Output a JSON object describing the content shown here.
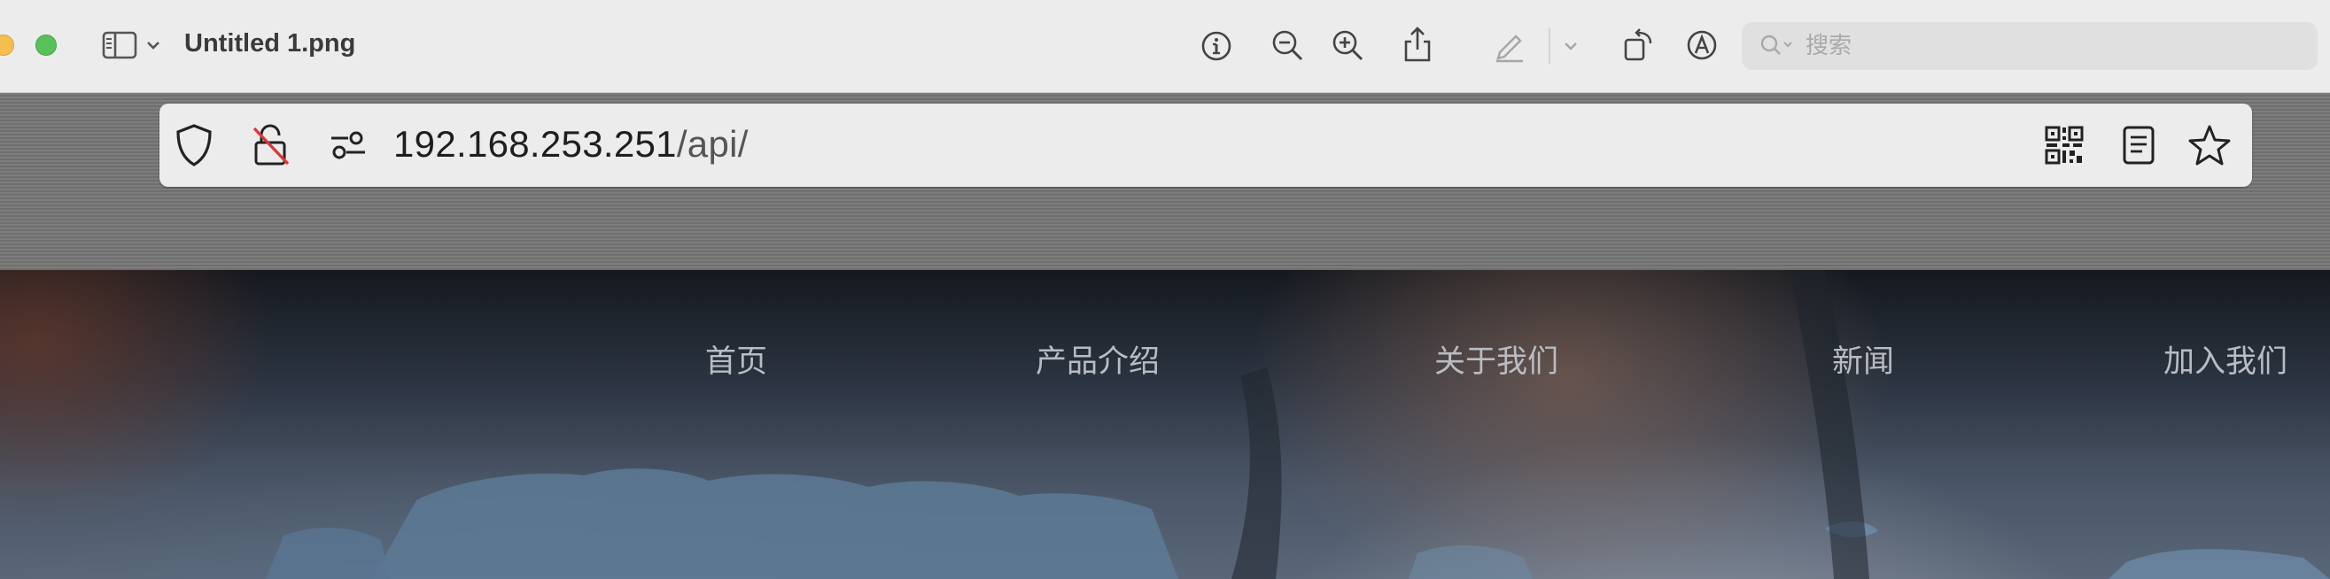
{
  "window": {
    "title": "Untitled 1.png",
    "search": {
      "placeholder": "搜索",
      "value": ""
    }
  },
  "toolbar_icons": [
    "sidebar-toggle-icon",
    "chevron-down-icon",
    "info-icon",
    "zoom-out-icon",
    "zoom-in-icon",
    "share-icon",
    "markup-pencil-icon",
    "markup-chevron-icon",
    "rotate-icon",
    "annotate-icon",
    "search-icon"
  ],
  "browser": {
    "url_host": "192.168.253.251",
    "url_path": "/api/",
    "icons": [
      "shield-icon",
      "insecure-lock-icon",
      "site-settings-icon",
      "qr-code-icon",
      "reader-mode-icon",
      "bookmark-star-icon"
    ]
  },
  "site_nav": {
    "items": [
      {
        "label": "首页"
      },
      {
        "label": "产品介绍"
      },
      {
        "label": "关于我们"
      },
      {
        "label": "新闻"
      },
      {
        "label": "加入我们"
      }
    ]
  },
  "colors": {
    "toolbar_bg": "#ececec",
    "traffic_yellow": "#f5bf4f",
    "traffic_green": "#5ac05a",
    "insecure_red": "#d63a3a",
    "nav_text": "#b9bcc2"
  }
}
